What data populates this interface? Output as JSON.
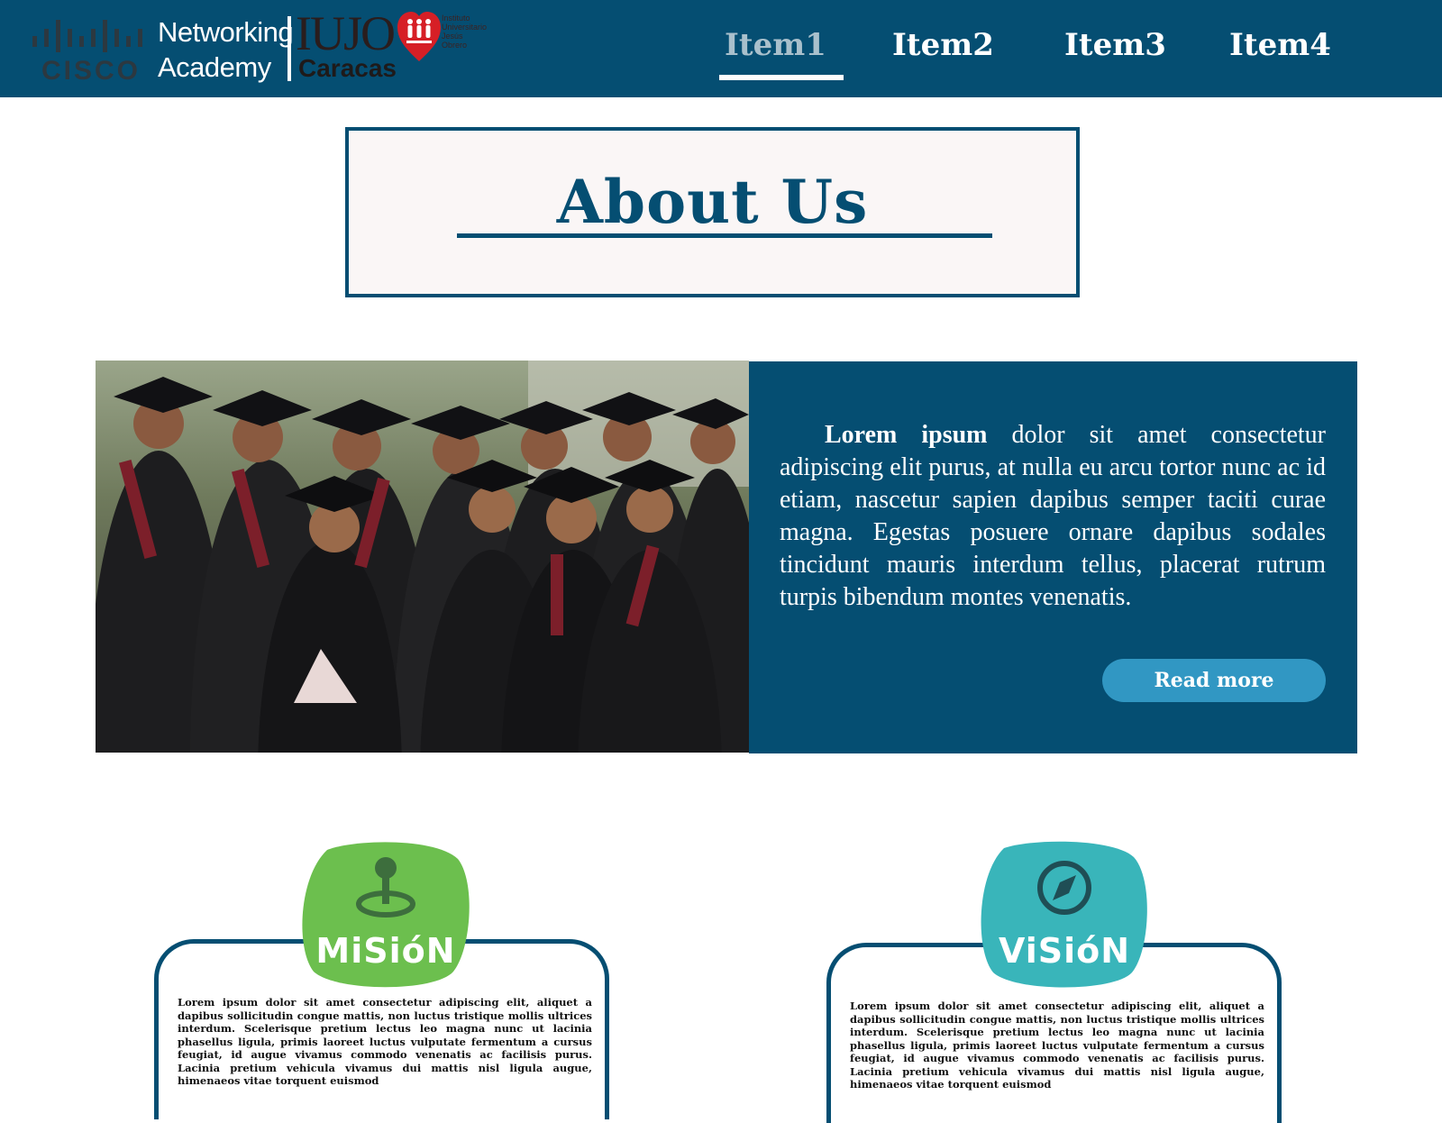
{
  "header": {
    "logo": {
      "cisco": "CISCO",
      "academy_line1": "Networking",
      "academy_line2": "Academy",
      "iujo": "IUJO",
      "city": "Caracas",
      "institute_lines": [
        "Instituto",
        "Universitario",
        "Jesús",
        "Obrero"
      ]
    },
    "nav": [
      {
        "label": "Item1",
        "active": true
      },
      {
        "label": "Item2",
        "active": false
      },
      {
        "label": "Item3",
        "active": false
      },
      {
        "label": "Item4",
        "active": false
      }
    ]
  },
  "about": {
    "title": "About Us"
  },
  "hero": {
    "lead": "Lorem ipsum",
    "body": " dolor sit amet consectetur adipiscing elit purus, at nulla eu arcu tortor nunc ac id etiam, nascetur sapien dapibus semper taciti curae magna. Egestas posuere ornare dapibus sodales tincidunt mauris interdum tellus, placerat rutrum turpis bibendum montes venenatis.",
    "button": "Read more"
  },
  "mission": {
    "label": "MiSióN",
    "text": "Lorem ipsum dolor sit amet consectetur adipiscing elit, aliquet a dapibus sollicitudin congue mattis, non luctus tristique mollis ultrices interdum. Scelerisque pretium lectus leo magna nunc ut lacinia phasellus ligula, primis laoreet luctus vulputate fermentum a cursus feugiat, id augue vivamus commodo venenatis ac facilisis purus. Lacinia pretium vehicula vivamus dui mattis nisl ligula augue, himenaeos vitae torquent euismod"
  },
  "vision": {
    "label": "ViSióN",
    "text": "Lorem ipsum dolor sit amet consectetur adipiscing elit, aliquet a dapibus sollicitudin congue mattis, non luctus tristique mollis ultrices interdum. Scelerisque pretium lectus leo magna nunc ut lacinia phasellus ligula, primis laoreet luctus vulputate fermentum a cursus feugiat, id augue vivamus commodo venenatis ac facilisis purus. Lacinia pretium vehicula vivamus dui mattis nisl ligula augue, himenaeos vitae torquent euismod"
  },
  "colors": {
    "primary": "#054e72",
    "button": "#3197c3",
    "mission_badge": "#6cbf4e",
    "vision_badge": "#39b5ba"
  },
  "icons": {
    "mission": "joystick-icon",
    "vision": "compass-icon"
  }
}
